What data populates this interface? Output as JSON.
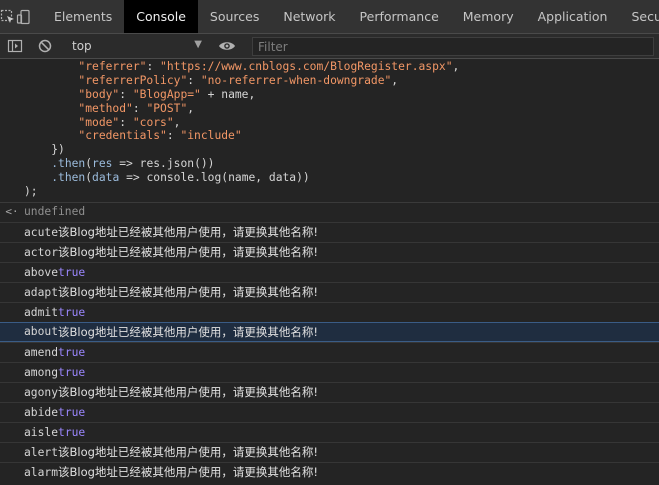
{
  "tabs": [
    {
      "label": "Elements"
    },
    {
      "label": "Console"
    },
    {
      "label": "Sources"
    },
    {
      "label": "Network"
    },
    {
      "label": "Performance"
    },
    {
      "label": "Memory"
    },
    {
      "label": "Application"
    },
    {
      "label": "Security"
    }
  ],
  "toolbar": {
    "context": "top",
    "filter_placeholder": "Filter"
  },
  "code": {
    "l1_key": "\"referrer\"",
    "l1_val": "\"https://www.cnblogs.com/BlogRegister.aspx\"",
    "l2_key": "\"referrerPolicy\"",
    "l2_val": "\"no-referrer-when-downgrade\"",
    "l3_key": "\"body\"",
    "l3_val": "\"BlogApp=\"",
    "l3_rest": " + name,",
    "l4_key": "\"method\"",
    "l4_val": "\"POST\"",
    "l5_key": "\"mode\"",
    "l5_val": "\"cors\"",
    "l6_key": "\"credentials\"",
    "l6_val": "\"include\"",
    "l7": "    })",
    "l8_then": ".then",
    "l8_open": "(",
    "l8_res": "res",
    "l8_rest": " => res.json())",
    "l9_then": ".then",
    "l9_open": "(",
    "l9_data": "data",
    "l9_rest": " => console.log(name, data))",
    "l10": ");"
  },
  "result": {
    "symbol": "<·",
    "text": "undefined"
  },
  "logs": [
    {
      "word": "acute",
      "msg": "该Blog地址已经被其他用户使用，请更换其他名称!"
    },
    {
      "word": "actor",
      "msg": "该Blog地址已经被其他用户使用，请更换其他名称!"
    },
    {
      "word": "above",
      "bool": "true"
    },
    {
      "word": "adapt",
      "msg": "该Blog地址已经被其他用户使用，请更换其他名称!"
    },
    {
      "word": "admit",
      "bool": "true"
    },
    {
      "word": "about",
      "msg": "该Blog地址已经被其他用户使用，请更换其他名称!"
    },
    {
      "word": "amend",
      "bool": "true"
    },
    {
      "word": "among",
      "bool": "true"
    },
    {
      "word": "agony",
      "msg": "该Blog地址已经被其他用户使用，请更换其他名称!"
    },
    {
      "word": "abide",
      "bool": "true"
    },
    {
      "word": "aisle",
      "bool": "true"
    },
    {
      "word": "alert",
      "msg": "该Blog地址已经被其他用户使用，请更换其他名称!"
    },
    {
      "word": "alarm",
      "msg": "该Blog地址已经被其他用户使用，请更换其他名称!"
    }
  ],
  "colors": {
    "panel_bg": "#242424",
    "tab_active_bg": "#000000",
    "string": "#f29766",
    "boolean": "#9a86fd",
    "identifier": "#9bbbdc"
  }
}
